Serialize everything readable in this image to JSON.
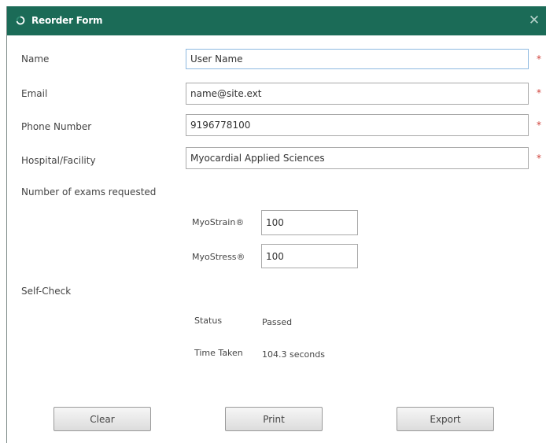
{
  "window": {
    "title": "Reorder Form",
    "close_glyph": "✕",
    "accent_color": "#1b6b57",
    "required_color": "#d0423b"
  },
  "form": {
    "name": {
      "label": "Name",
      "value": "User Name",
      "required_marker": "*"
    },
    "email": {
      "label": "Email",
      "value": "name@site.ext",
      "required_marker": "*"
    },
    "phone": {
      "label": "Phone Number",
      "value": "9196778100",
      "required_marker": "*"
    },
    "facility": {
      "label": "Hospital/Facility",
      "value": "Myocardial Applied Sciences",
      "required_marker": "*"
    }
  },
  "exams": {
    "heading": "Number of exams requested",
    "myostrain": {
      "label": "MyoStrain®",
      "value": "100"
    },
    "myostress": {
      "label": "MyoStress®",
      "value": "100"
    }
  },
  "selfcheck": {
    "heading": "Self-Check",
    "status_label": "Status",
    "status_value": "Passed",
    "time_label": "Time Taken",
    "time_value": "104.3 seconds"
  },
  "buttons": {
    "clear": "Clear",
    "print": "Print",
    "export": "Export"
  },
  "icons": {
    "title_icon": "spinner-icon",
    "close_icon": "close-icon"
  }
}
